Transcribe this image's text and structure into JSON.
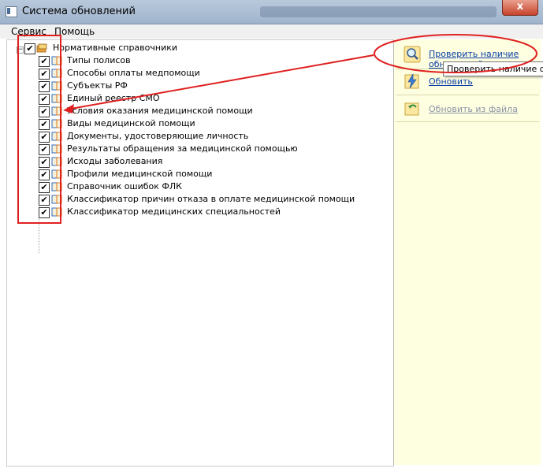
{
  "window": {
    "title": "Система обновлений",
    "close_glyph": "x"
  },
  "menu": [
    {
      "label": "Сервис"
    },
    {
      "label": "Помощь"
    }
  ],
  "tree": {
    "root": {
      "label": "Нормативные справочники",
      "checked": true,
      "expander": "−"
    },
    "items": [
      {
        "label": "Типы полисов"
      },
      {
        "label": "Способы оплаты медпомощи"
      },
      {
        "label": "Субъекты РФ"
      },
      {
        "label": "Единый реестр СМО"
      },
      {
        "label": "Условия оказания медицинской помощи"
      },
      {
        "label": "Виды медицинской помощи"
      },
      {
        "label": "Документы, удостоверяющие личность"
      },
      {
        "label": "Результаты обращения за медицинской помощью"
      },
      {
        "label": "Исходы заболевания"
      },
      {
        "label": "Профили медицинской помощи"
      },
      {
        "label": "Справочник ошибок ФЛК"
      },
      {
        "label": "Классификатор причин отказа в оплате медицинской помощи"
      },
      {
        "label": "Классификатор медицинских специальностей"
      }
    ],
    "check_glyph": "✔"
  },
  "actions": {
    "check": {
      "label_line1": "Проверить наличие",
      "label_line2": "обновлений",
      "icon": "magnifier-icon"
    },
    "update": {
      "label": "Обновить",
      "icon": "lightning-icon"
    },
    "from_file": {
      "label": "Обновить из файла",
      "icon": "folder-icon"
    }
  },
  "tooltip": {
    "text": "Проверить наличие обновлений"
  },
  "colors": {
    "annotation_red": "#e02020",
    "panel_bg": "#fefee0",
    "link": "#0b3fa8"
  }
}
